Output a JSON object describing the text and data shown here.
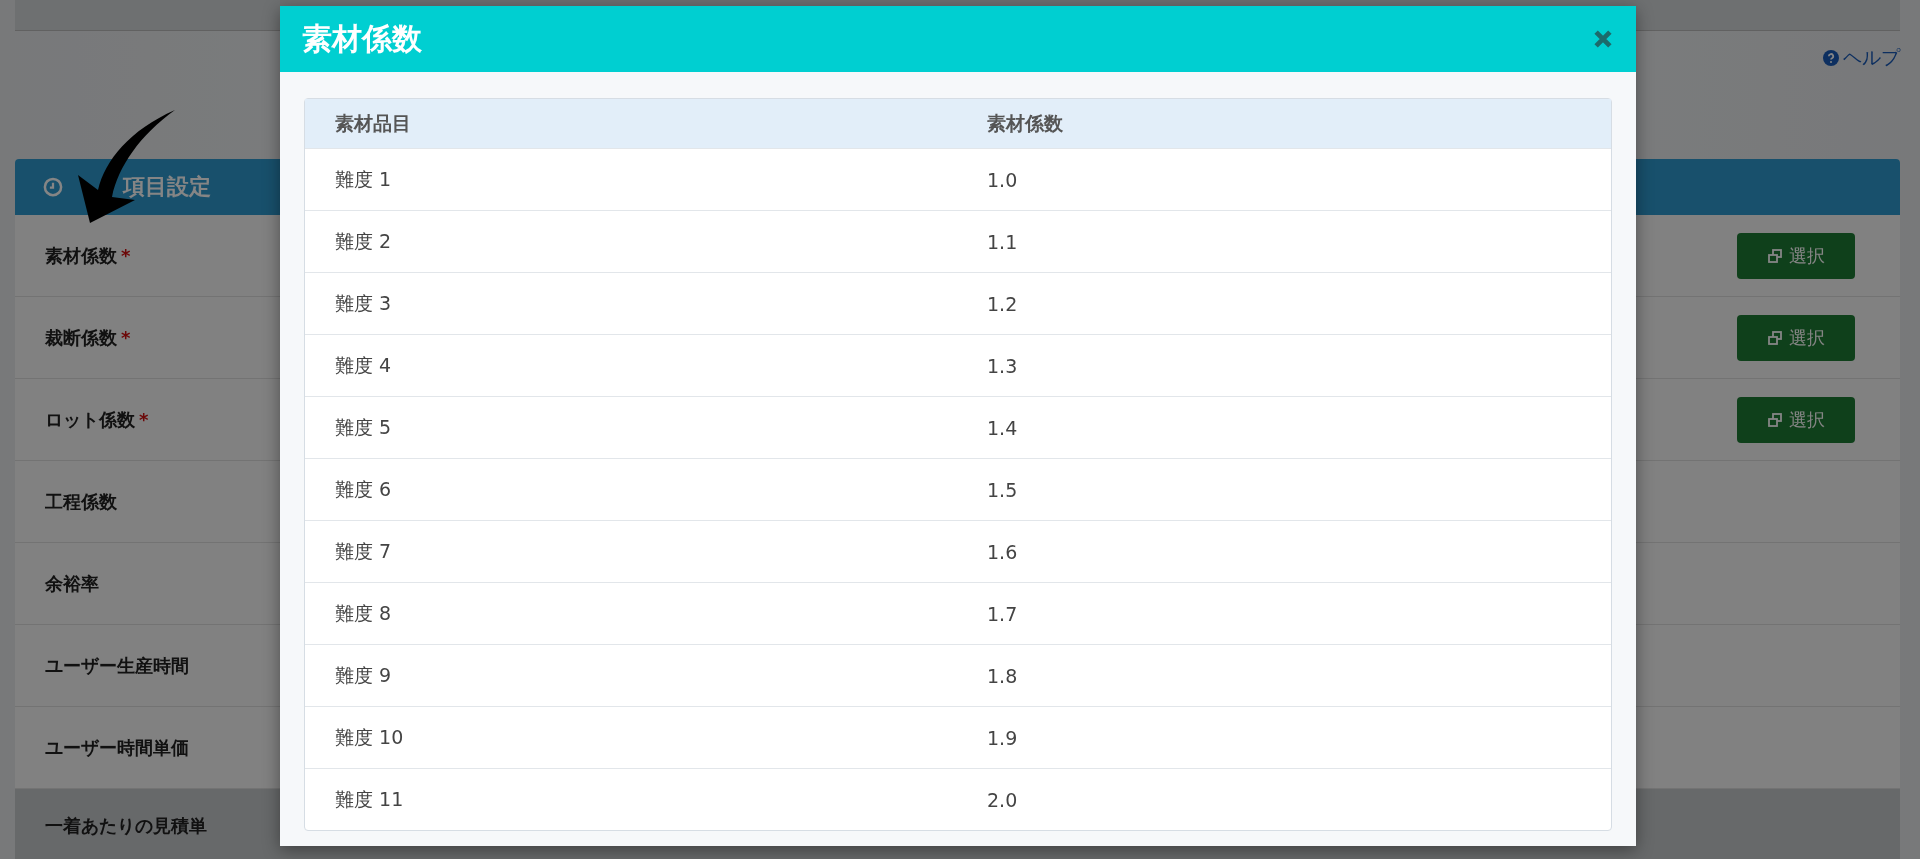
{
  "top_help": {
    "label": "ヘルプ"
  },
  "panel": {
    "title": "項目設定",
    "rows": [
      {
        "label": "素材係数",
        "required_mark": "*",
        "button": "選択"
      },
      {
        "label": "裁断係数",
        "required_mark": "*",
        "button": "選択"
      },
      {
        "label": "ロット係数",
        "required_mark": "*",
        "button": "選択"
      },
      {
        "label": "工程係数"
      },
      {
        "label": "余裕率"
      },
      {
        "label": "ユーザー生産時間"
      },
      {
        "label": "ユーザー時間単価"
      }
    ],
    "total_label": "一着あたりの見積単"
  },
  "modal": {
    "title": "素材係数",
    "columns": [
      "素材品目",
      "素材係数"
    ],
    "rows": [
      [
        "難度 1",
        "1.0"
      ],
      [
        "難度 2",
        "1.1"
      ],
      [
        "難度 3",
        "1.2"
      ],
      [
        "難度 4",
        "1.3"
      ],
      [
        "難度 5",
        "1.4"
      ],
      [
        "難度 6",
        "1.5"
      ],
      [
        "難度 7",
        "1.6"
      ],
      [
        "難度 8",
        "1.7"
      ],
      [
        "難度 9",
        "1.8"
      ],
      [
        "難度 10",
        "1.9"
      ],
      [
        "難度 11",
        "2.0"
      ]
    ]
  }
}
